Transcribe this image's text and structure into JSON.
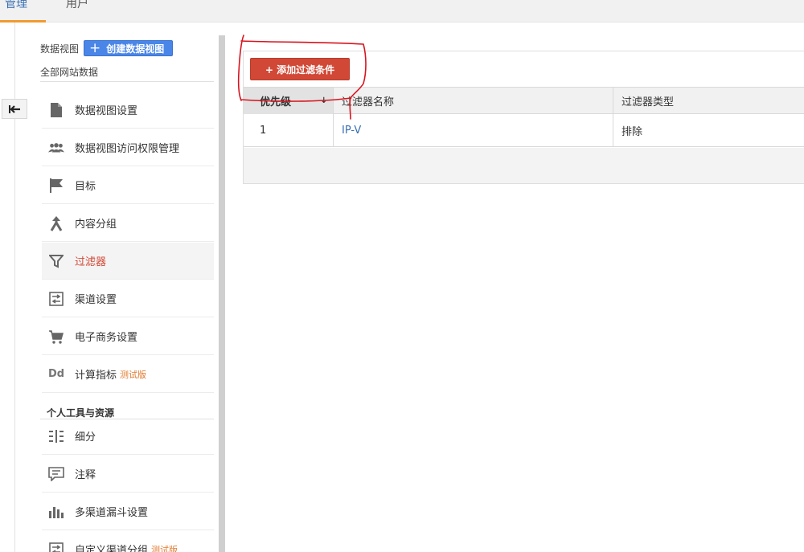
{
  "topbar": {
    "tabs": [
      {
        "label": "管理",
        "active": true
      },
      {
        "label": "用户",
        "active": false
      }
    ]
  },
  "sidebar": {
    "view_label": "数据视图",
    "create_button": "创建数据视图",
    "site_name": "全部网站数据",
    "items": [
      {
        "label": "数据视图设置",
        "icon": "document-icon"
      },
      {
        "label": "数据视图访问权限管理",
        "icon": "users-icon"
      },
      {
        "label": "目标",
        "icon": "flag-icon"
      },
      {
        "label": "内容分组",
        "icon": "merge-icon"
      },
      {
        "label": "过滤器",
        "icon": "filter-icon",
        "active": true
      },
      {
        "label": "渠道设置",
        "icon": "channel-settings-icon"
      },
      {
        "label": "电子商务设置",
        "icon": "cart-icon"
      },
      {
        "label": "计算指标",
        "icon": "dd-icon",
        "badge": "测试版"
      }
    ],
    "section_title": "个人工具与资源",
    "tools": [
      {
        "label": "细分",
        "icon": "segments-icon"
      },
      {
        "label": "注释",
        "icon": "comment-icon"
      },
      {
        "label": "多渠道漏斗设置",
        "icon": "bar-chart-icon"
      },
      {
        "label": "自定义渠道分组",
        "icon": "custom-channel-icon",
        "badge": "测试版"
      }
    ]
  },
  "main": {
    "add_filter_button": "+ 添加过滤条件",
    "table": {
      "headers": [
        "优先级",
        "过滤器名称",
        "过滤器类型"
      ],
      "rows": [
        {
          "priority": "1",
          "name": "IP-V",
          "type": "排除"
        }
      ]
    }
  },
  "colors": {
    "accent_blue": "#4a86e8",
    "action_red": "#d14836",
    "tab_underline": "#f29a2e",
    "beta_orange": "#e07a2e",
    "annotation_red": "#d8141e"
  }
}
